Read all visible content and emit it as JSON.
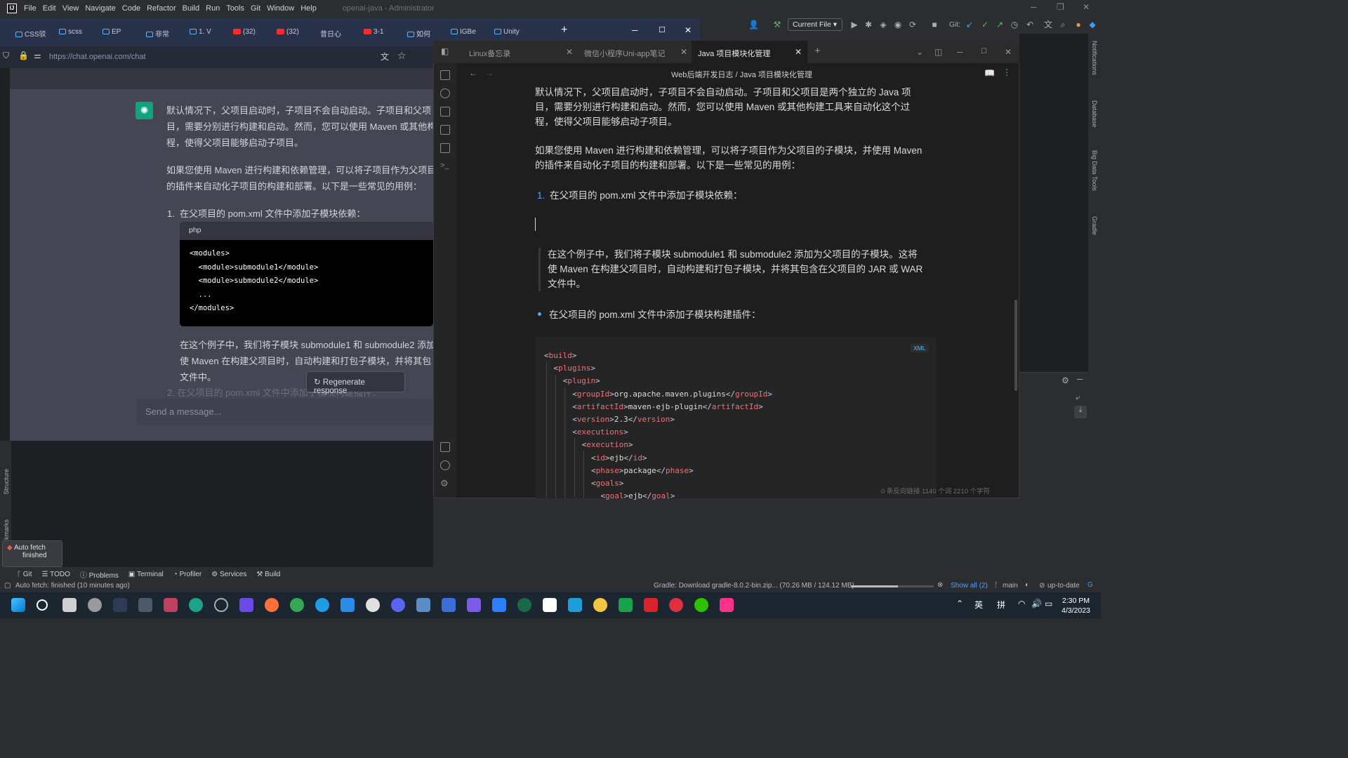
{
  "ide": {
    "menu": [
      "File",
      "Edit",
      "View",
      "Navigate",
      "Code",
      "Refactor",
      "Build",
      "Run",
      "Tools",
      "Git",
      "Window",
      "Help"
    ],
    "window_title": "openai-java - Administrator",
    "run_config": "Current File",
    "git_label": "Git:",
    "right_stripe": [
      "Notifications",
      "Database",
      "Big Data Tools",
      "Gradle"
    ],
    "left_stripe": [
      "Structure",
      "kmarks"
    ],
    "tool_tabs": [
      "Git",
      "TODO",
      "Problems",
      "Terminal",
      "Profiler",
      "Services",
      "Build"
    ],
    "auto_fetch_popup": {
      "title": "Auto fetch",
      "subtitle": "finished"
    },
    "status_left": "Auto fetch: finished (10 minutes ago)",
    "status_gradle": "Gradle: Download gradle-8.0.2-bin.zip...   (70.26 MB / 124.12 MB)",
    "gradle_progress": 0.566,
    "status_show_all": "Show all (2)",
    "status_branch": "main",
    "status_uptodate": "up-to-date"
  },
  "browser": {
    "tabs": [
      {
        "label": "CSS驳",
        "icon": "bilibili-icon"
      },
      {
        "label": "scss",
        "icon": "bilibili-icon"
      },
      {
        "label": "EP",
        "icon": "bilibili-icon"
      },
      {
        "label": "非常",
        "icon": "bilibili-icon"
      },
      {
        "label": "1. V",
        "icon": "bilibili-icon"
      },
      {
        "label": "(32)",
        "icon": "youtube-icon"
      },
      {
        "label": "(32)",
        "icon": "youtube-icon"
      },
      {
        "label": "昔日心",
        "icon": "none"
      },
      {
        "label": "3-1",
        "icon": "youtube-icon"
      },
      {
        "label": "如何",
        "icon": "bilibili-icon"
      },
      {
        "label": "IGBe",
        "icon": "bilibili-icon"
      },
      {
        "label": "Unity",
        "icon": "bilibili-icon"
      }
    ],
    "url": "https://chat.openai.com/chat"
  },
  "chat": {
    "p1": [
      "默认情况下，父项目启动时，子项目不会自动启动。子项目和父项",
      "目，需要分别进行构建和启动。然而，您可以使用 Maven 或其他构",
      "程，使得父项目能够启动子项目。"
    ],
    "p2": [
      "如果您使用 Maven 进行构建和依赖管理，可以将子项目作为父项目",
      "的插件来自动化子项目的构建和部署。以下是一些常见的用例："
    ],
    "li1_num": "1.",
    "li1": "在父项目的 pom.xml 文件中添加子模块依赖：",
    "code_lang": "php",
    "code": "<modules>\n  <module>submodule1</module>\n  <module>submodule2</module>\n  ...\n</modules>",
    "p3": [
      "在这个例子中，我们将子模块 submodule1 和 submodule2 添加",
      "使 Maven 在构建父项目时，自动构建和打包子模块，并将其包",
      "文件中。"
    ],
    "li2_partial": "2.  在父项目的 pom.xml 文件中添加子模块构建插件：",
    "regenerate": "Regenerate response",
    "send_placeholder": "Send a message..."
  },
  "notes": {
    "tabs": [
      "Linux备忘录",
      "微信小程序Uni-app笔记",
      "Java 项目模块化管理"
    ],
    "breadcrumb": "Web后端开发日志 / Java 项目模块化管理",
    "p1": [
      "默认情况下，父项目启动时，子项目不会自动启动。子项目和父项目是两个独立的 Java 项",
      "目，需要分别进行构建和启动。然而，您可以使用 Maven 或其他构建工具来自动化这个过",
      "程，使得父项目能够启动子项目。"
    ],
    "p2": [
      "如果您使用 Maven 进行构建和依赖管理，可以将子项目作为父项目的子模块，并使用 Maven",
      "的插件来自动化子项目的构建和部署。以下是一些常见的用例："
    ],
    "li1_num": "1.",
    "li1": "在父项目的 pom.xml 文件中添加子模块依赖：",
    "quote": [
      "在这个例子中，我们将子模块 submodule1 和 submodule2 添加为父项目的子模块。这将",
      "使 Maven 在构建父项目时，自动构建和打包子模块，并将其包含在父项目的 JAR 或 WAR",
      "文件中。"
    ],
    "bullet": "在父项目的 pom.xml 文件中添加子模块构建插件：",
    "code_badge": "XML",
    "xml": [
      {
        "open": "build",
        "text": "",
        "close": ""
      },
      {
        "open": "plugins",
        "text": "",
        "close": ""
      },
      {
        "open": "plugin",
        "text": "",
        "close": ""
      },
      {
        "open": "groupId",
        "text": "org.apache.maven.plugins",
        "close": "groupId"
      },
      {
        "open": "artifactId",
        "text": "maven-ejb-plugin",
        "close": "artifactId"
      },
      {
        "open": "version",
        "text": "2.3",
        "close": "version"
      },
      {
        "open": "executions",
        "text": "",
        "close": ""
      },
      {
        "open": "execution",
        "text": "",
        "close": ""
      },
      {
        "open": "id",
        "text": "ejb",
        "close": "id"
      },
      {
        "open": "phase",
        "text": "package",
        "close": "phase"
      },
      {
        "open": "goals",
        "text": "",
        "close": ""
      },
      {
        "open": "goal",
        "text": "ejb",
        "close": "goal"
      }
    ],
    "footer": "0 条反向链接    1140 个词   2210 个字符"
  },
  "taskbar": {
    "lang1": "英",
    "lang2": "拼",
    "time": "2:30 PM",
    "date": "4/3/2023"
  }
}
